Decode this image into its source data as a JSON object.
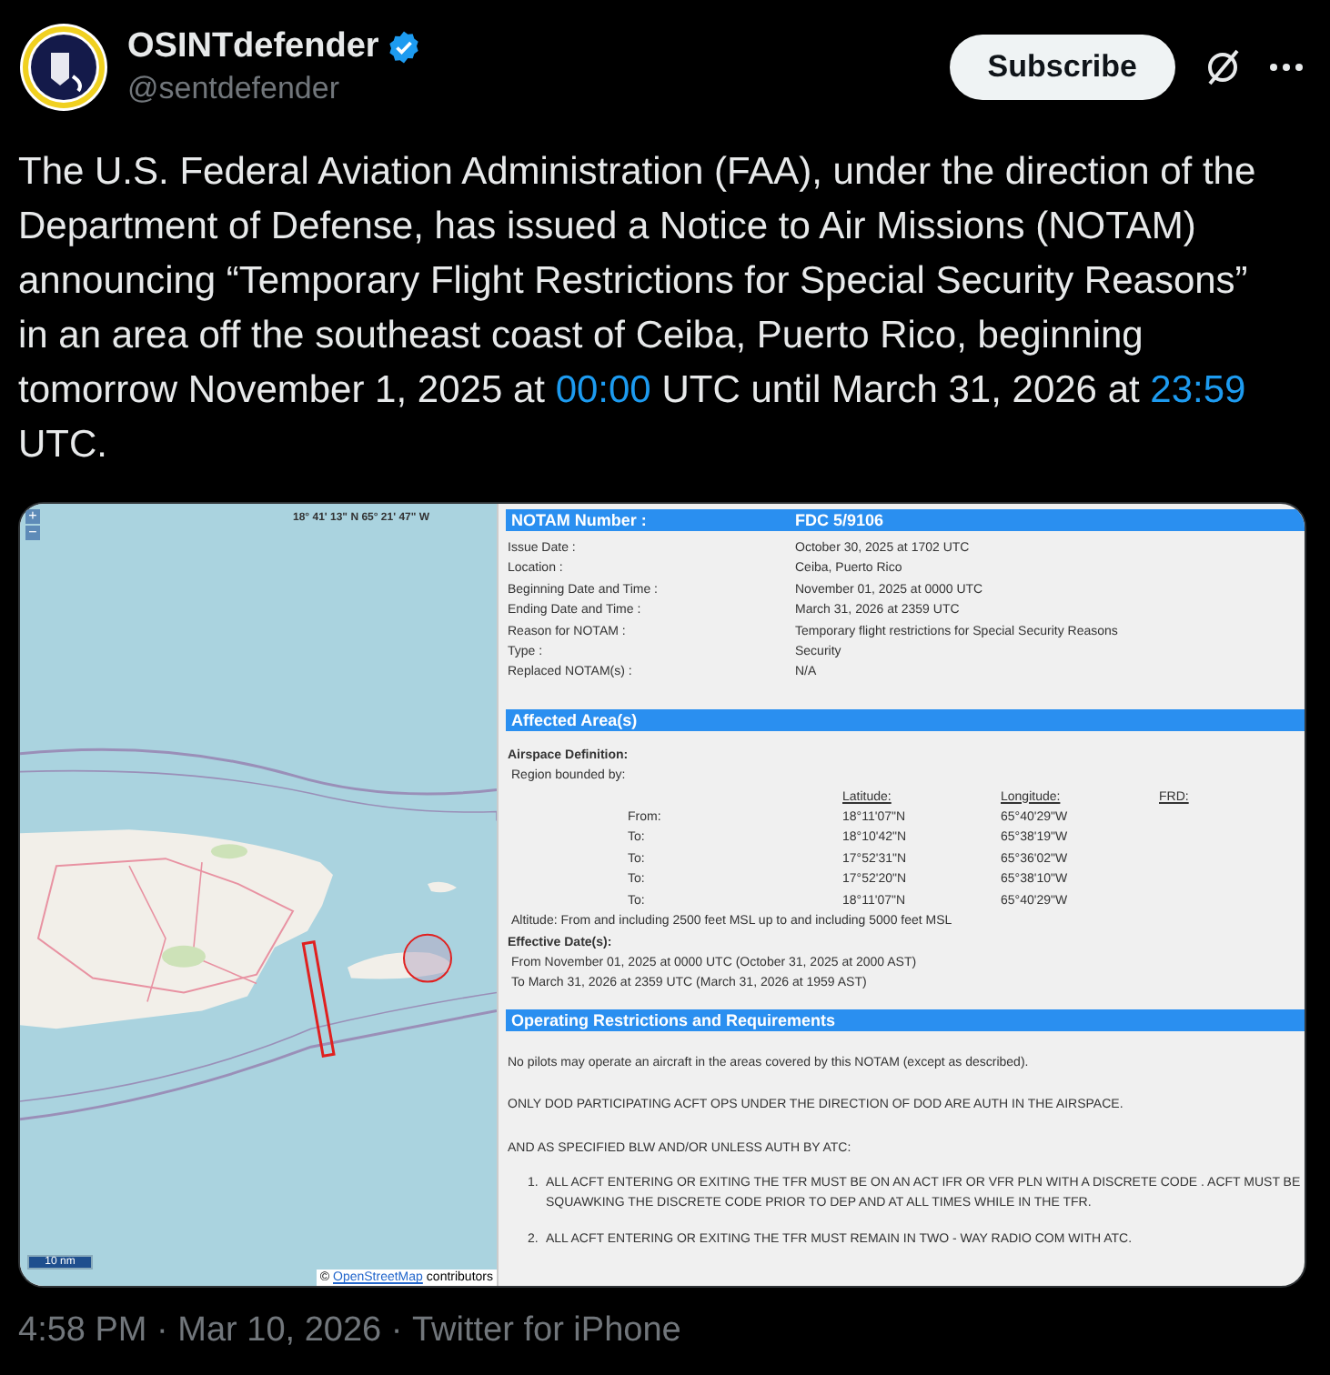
{
  "author": {
    "name": "OSINTdefender",
    "verified": true,
    "handle": "@sentdefender"
  },
  "subscribe_button": "Subscribe",
  "tweet_text": [
    {
      "kind": "plain",
      "text": "The U.S. Federal Aviation Administration (FAA), under the direction of the Department of Defense, has issued a Notice to Air Missions (NOTAM) announcing “Temporary Flight Restrictions for Special Security Reasons” in an area off the southeast coast of Ceiba, Puerto Rico, beginning tomorrow November 1, 2025 at "
    },
    {
      "kind": "link",
      "text": "00:00"
    },
    {
      "kind": "plain",
      "text": " UTC until March 31, 2026 at "
    },
    {
      "kind": "link",
      "text": "23:59"
    },
    {
      "kind": "plain",
      "text": " UTC."
    }
  ],
  "map": {
    "zoom_in": "+",
    "zoom_out": "−",
    "coordinates": "18° 41' 13\" N 65° 21' 47\" W",
    "scale": "10 nm",
    "attribution_symbol": "©",
    "attribution_link": "OpenStreetMap",
    "attribution_text": "contributors"
  },
  "notam": {
    "number_label": "NOTAM Number :",
    "number": "FDC 5/9106",
    "details": [
      {
        "label": "Issue Date :",
        "value": "October 30, 2025 at 1702 UTC"
      },
      {
        "label": "Location :",
        "value": "Ceiba, Puerto Rico"
      },
      {
        "label": "Beginning Date and Time :",
        "value": "November 01, 2025 at 0000 UTC"
      },
      {
        "label": "Ending Date and Time :",
        "value": "March 31, 2026 at 2359 UTC"
      },
      {
        "label": "Reason for NOTAM :",
        "value": "Temporary flight restrictions for Special Security Reasons"
      },
      {
        "label": "Type :",
        "value": "Security"
      },
      {
        "label": "Replaced NOTAM(s) :",
        "value": "N/A"
      }
    ],
    "affected_heading": "Affected Area(s)",
    "airspace_definition": "Airspace Definition:",
    "region_bounded": "Region bounded by:",
    "columns": [
      "Latitude:",
      "Longitude:",
      "FRD:"
    ],
    "points": [
      {
        "label": "From:",
        "latitude": "18°11'07\"N",
        "longitude": "65°40'29\"W"
      },
      {
        "label": "To:",
        "latitude": "18°10'42\"N",
        "longitude": "65°38'19\"W"
      },
      {
        "label": "To:",
        "latitude": "17°52'31\"N",
        "longitude": "65°36'02\"W"
      },
      {
        "label": "To:",
        "latitude": "17°52'20\"N",
        "longitude": "65°38'10\"W"
      },
      {
        "label": "To:",
        "latitude": "18°11'07\"N",
        "longitude": "65°40'29\"W"
      }
    ],
    "altitude": "Altitude: From and including 2500 feet MSL up to and including 5000 feet MSL",
    "effective_heading": "Effective Date(s):",
    "effective_dates": [
      "From November 01, 2025 at 0000 UTC (October 31, 2025 at 2000 AST)",
      "To March 31, 2026 at 2359 UTC (March 31, 2026 at 1959 AST)"
    ],
    "restrictions_heading": "Operating Restrictions and Requirements",
    "paragraphs": [
      "No pilots may operate an aircraft in the areas covered by this NOTAM (except as described).",
      "ONLY DOD PARTICIPATING ACFT OPS UNDER THE DIRECTION OF DOD ARE AUTH IN THE AIRSPACE.",
      "AND AS SPECIFIED BLW AND/OR UNLESS AUTH BY ATC:"
    ],
    "requirements": [
      {
        "number": "1.",
        "text": "ALL ACFT ENTERING OR EXITING THE TFR MUST BE ON AN ACT IFR OR VFR PLN WITH A DISCRETE CODE . ACFT MUST BE SQUAWKING THE DISCRETE CODE PRIOR TO DEP AND AT ALL TIMES WHILE IN THE TFR."
      },
      {
        "number": "2.",
        "text": "ALL ACFT ENTERING OR EXITING THE TFR MUST REMAIN IN TWO - WAY RADIO COM WITH ATC."
      }
    ]
  },
  "footer": {
    "time": "4:58 PM · Mar 10, 2026 · ",
    "source": "Twitter for iPhone"
  }
}
